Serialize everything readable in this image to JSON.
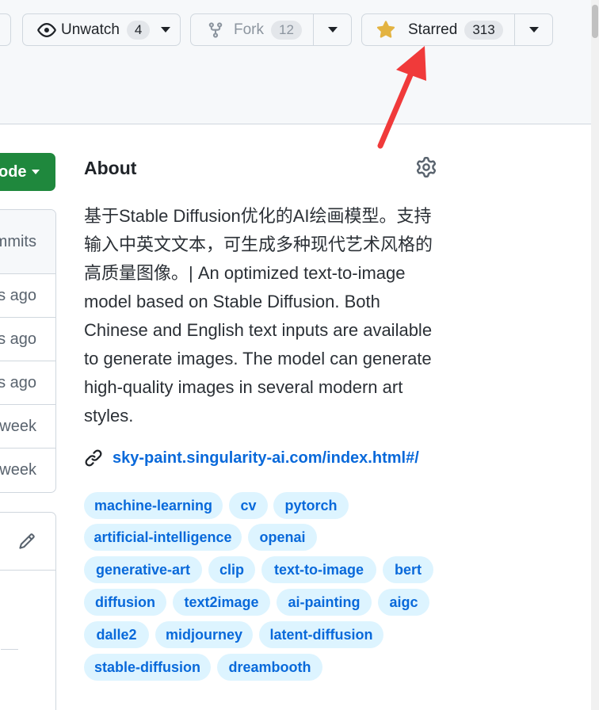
{
  "header": {
    "unwatch": {
      "label": "Unwatch",
      "count": "4",
      "icon": "eye-icon"
    },
    "fork": {
      "label": "Fork",
      "count": "12",
      "icon": "fork-icon"
    },
    "star": {
      "label": "Starred",
      "count": "313",
      "icon": "star-filled-icon",
      "color": "#e3b341"
    }
  },
  "annotation": {
    "color": "#f03a3a"
  },
  "code_button": {
    "label": "ode"
  },
  "commits": {
    "header": "mmits",
    "rows": [
      "s ago",
      "s ago",
      "s ago",
      "week",
      "week"
    ]
  },
  "about": {
    "title": "About",
    "description": "基于Stable Diffusion优化的AI绘画模型。支持输入中英文文本，可生成多种现代艺术风格的高质量图像。| An optimized text-to-image model based on Stable Diffusion. Both Chinese and English text inputs are available to generate images. The model can generate high-quality images in several modern art styles.",
    "link": "sky-paint.singularity-ai.com/index.html#/",
    "topics": [
      "machine-learning",
      "cv",
      "pytorch",
      "artificial-intelligence",
      "openai",
      "generative-art",
      "clip",
      "text-to-image",
      "bert",
      "diffusion",
      "text2image",
      "ai-painting",
      "aigc",
      "dalle2",
      "midjourney",
      "latent-diffusion",
      "stable-diffusion",
      "dreambooth"
    ]
  },
  "colors": {
    "accent": "#0969da",
    "topic_bg": "#ddf4ff",
    "green": "#1f883d"
  }
}
